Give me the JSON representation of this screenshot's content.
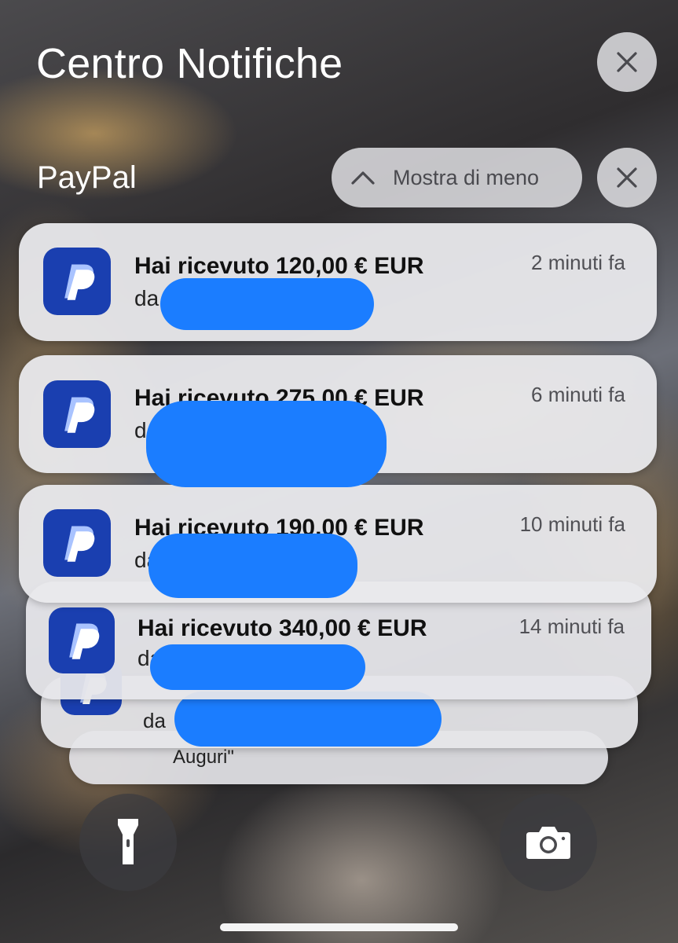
{
  "header": {
    "title": "Centro Notifiche"
  },
  "group": {
    "app_name": "PayPal",
    "show_less_label": "Mostra di meno"
  },
  "notifications": [
    {
      "title": "Hai ricevuto 120,00 € EUR",
      "body": "da",
      "time": "2 minuti fa"
    },
    {
      "title": "Hai ricevuto 275,00 € EUR",
      "body": "da",
      "time": "6 minuti fa"
    },
    {
      "title": "Hai ricevuto 190,00 € EUR",
      "body": "da",
      "time": "10 minuti fa"
    },
    {
      "title": "Hai ricevuto 340,00 € EUR",
      "body": "da",
      "time": "14 minuti fa"
    },
    {
      "title": "",
      "body": "da",
      "time": ""
    },
    {
      "title": "",
      "body": "Auguri\"",
      "time": ""
    }
  ],
  "colors": {
    "paypal_icon_bg": "#1a3fb0",
    "redaction": "#1b7dff"
  },
  "icons": {
    "close": "close-icon",
    "chevron": "chevron-up-icon",
    "app": "paypal-logo-icon",
    "torch": "flashlight-icon",
    "camera": "camera-icon"
  }
}
